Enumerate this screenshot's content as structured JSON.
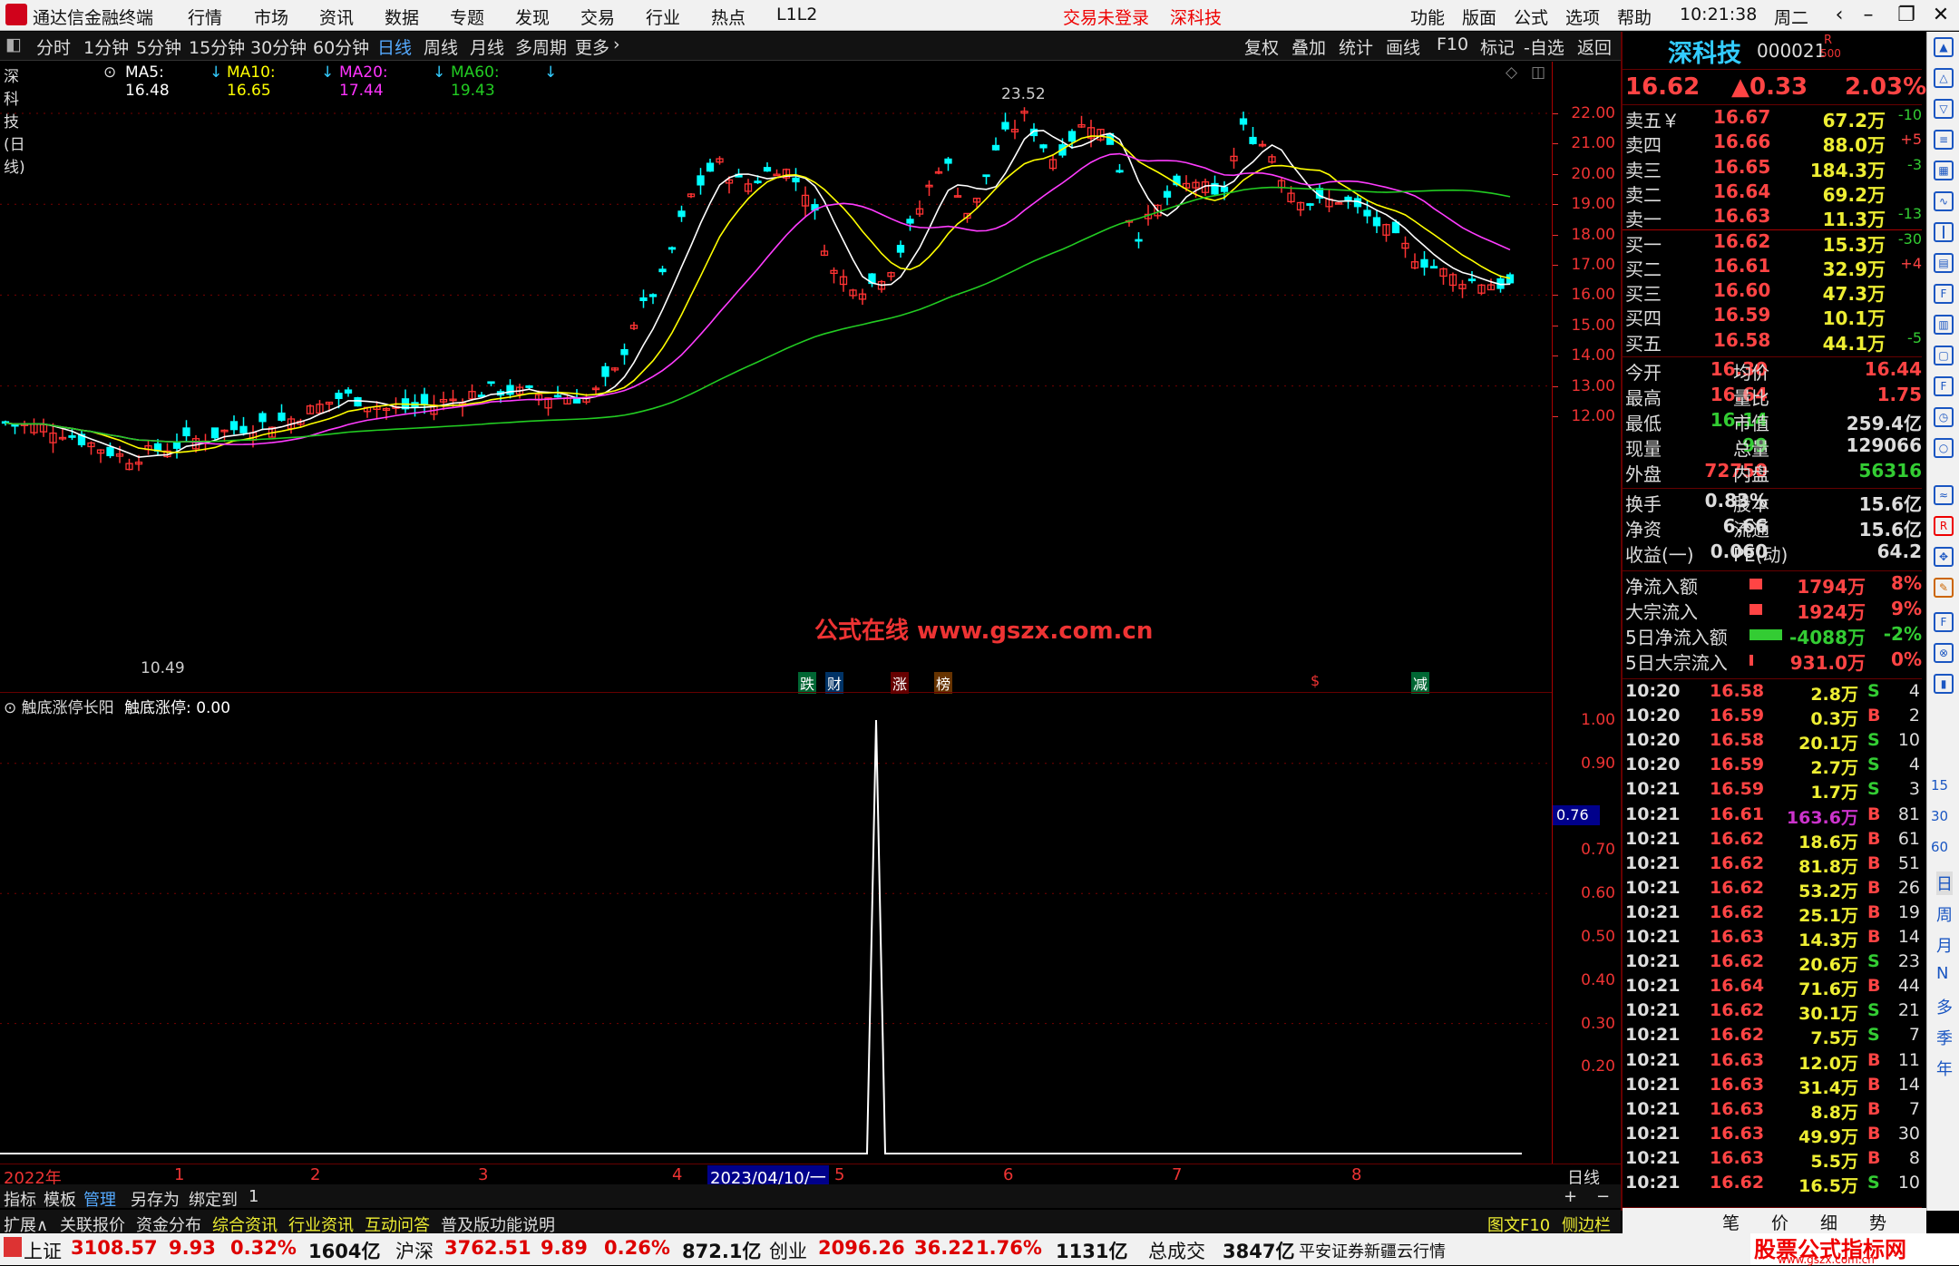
{
  "titlebar": {
    "app_name": "通达信金融终端",
    "menus": [
      "行情",
      "市场",
      "资讯",
      "数据",
      "专题",
      "发现",
      "交易",
      "行业",
      "热点",
      "L1L2"
    ],
    "trade_status": "交易未登录",
    "stock_name": "深科技",
    "right_menus": [
      "功能",
      "版面",
      "公式",
      "选项",
      "帮助"
    ],
    "time": "10:21:38",
    "weekday": "周二"
  },
  "timeframes": [
    "分时",
    "1分钟",
    "5分钟",
    "15分钟",
    "30分钟",
    "60分钟",
    "日线",
    "周线",
    "月线",
    "多周期",
    "更多"
  ],
  "active_timeframe": "日线",
  "tools": [
    "复权",
    "叠加",
    "统计",
    "画线",
    "F10",
    "标记",
    "-自选",
    "返回"
  ],
  "ma_bar": {
    "title": "深科技(日线)",
    "ma5": "MA5: 16.48",
    "ma10": "MA10: 16.65",
    "ma20": "MA20: 17.44",
    "ma60": "MA60: 19.43"
  },
  "colors": {
    "ma5": "#ffffff",
    "ma10": "#ffff00",
    "ma20": "#ff3cff",
    "ma60": "#22cc22",
    "up": "#ff3333",
    "down": "#00ffff"
  },
  "price_axis": [
    "22.00",
    "21.00",
    "20.00",
    "19.00",
    "18.00",
    "17.00",
    "16.00",
    "15.00",
    "14.00",
    "13.00",
    "12.00"
  ],
  "price_high_label": "23.52",
  "price_low_label": "10.49",
  "watermark": "公式在线  www.gszx.com.cn",
  "event_tags": [
    "跌",
    "财",
    "涨",
    "榜",
    "$",
    "减"
  ],
  "indicator": {
    "name": "触底涨停长阳",
    "value_label": "触底涨停: 0.00",
    "axis": [
      "1.00",
      "0.90",
      "0.70",
      "0.60",
      "0.50",
      "0.40",
      "0.30",
      "0.20"
    ],
    "current_tag": "0.76"
  },
  "x_axis": {
    "labels": [
      "2022年",
      "1",
      "2",
      "3",
      "4",
      "2023/04/10/一",
      "5",
      "6",
      "7",
      "8"
    ],
    "period": "日线"
  },
  "bottom_tabs1": [
    "指标",
    "模板",
    "管理",
    "另存为",
    "绑定到",
    "1"
  ],
  "bottom_tabs2": [
    "扩展∧",
    "关联报价",
    "资金分布",
    "综合资讯",
    "行业资讯",
    "互动问答",
    "普及版功能说明"
  ],
  "bottom_right": [
    "图文F10",
    "侧边栏《"
  ],
  "quote": {
    "name": "深科技",
    "code": "000021",
    "margin_tag": "R",
    "margin_sub": "500",
    "price": "16.62",
    "change": "▲0.33",
    "pct": "2.03%",
    "asks": [
      {
        "label": "卖五￥",
        "price": "16.67",
        "vol": "67.2万",
        "chg": "-10"
      },
      {
        "label": "卖四",
        "price": "16.66",
        "vol": "88.0万",
        "chg": "+5"
      },
      {
        "label": "卖三",
        "price": "16.65",
        "vol": "184.3万",
        "chg": "-3"
      },
      {
        "label": "卖二",
        "price": "16.64",
        "vol": "69.2万",
        "chg": ""
      },
      {
        "label": "卖一",
        "price": "16.63",
        "vol": "11.3万",
        "chg": "-13"
      }
    ],
    "bids": [
      {
        "label": "买一",
        "price": "16.62",
        "vol": "15.3万",
        "chg": "-30"
      },
      {
        "label": "买二",
        "price": "16.61",
        "vol": "32.9万",
        "chg": "+4"
      },
      {
        "label": "买三",
        "price": "16.60",
        "vol": "47.3万",
        "chg": ""
      },
      {
        "label": "买四",
        "price": "16.59",
        "vol": "10.1万",
        "chg": ""
      },
      {
        "label": "买五",
        "price": "16.58",
        "vol": "44.1万",
        "chg": "-5"
      }
    ],
    "stats": [
      {
        "l1": "今开",
        "v1": "16.30",
        "l2": "均价",
        "v2": "16.44"
      },
      {
        "l1": "最高",
        "v1": "16.64",
        "l2": "量比",
        "v2": "1.75"
      },
      {
        "l1": "最低",
        "v1": "16.14",
        "l2": "市值",
        "v2": "259.4亿"
      },
      {
        "l1": "现量",
        "v1": "99",
        "l2": "总量",
        "v2": "129066"
      },
      {
        "l1": "外盘",
        "v1": "72750",
        "l2": "内盘",
        "v2": "56316"
      }
    ],
    "stats2": [
      {
        "l1": "换手",
        "v1": "0.83%",
        "l2": "股本",
        "v2": "15.6亿"
      },
      {
        "l1": "净资",
        "v1": "6.66",
        "l2": "流通",
        "v2": "15.6亿"
      },
      {
        "l1": "收益(一)",
        "v1": "0.060",
        "l2": "PE(动)",
        "v2": "64.2"
      }
    ],
    "flows": [
      {
        "label": "净流入额",
        "value": "1794万",
        "pct": "8%"
      },
      {
        "label": "大宗流入",
        "value": "1924万",
        "pct": "9%"
      },
      {
        "label": "5日净流入额",
        "value": "-4088万",
        "pct": "-2%"
      },
      {
        "label": "5日大宗流入",
        "value": "931.0万",
        "pct": "0%"
      }
    ],
    "ticks": [
      {
        "t": "10:20",
        "p": "16.58",
        "v": "2.8万",
        "s": "S",
        "n": "4"
      },
      {
        "t": "10:20",
        "p": "16.59",
        "v": "0.3万",
        "s": "B",
        "n": "2"
      },
      {
        "t": "10:20",
        "p": "16.58",
        "v": "20.1万",
        "s": "S",
        "n": "10"
      },
      {
        "t": "10:20",
        "p": "16.59",
        "v": "2.7万",
        "s": "S",
        "n": "4"
      },
      {
        "t": "10:21",
        "p": "16.59",
        "v": "1.7万",
        "s": "S",
        "n": "3"
      },
      {
        "t": "10:21",
        "p": "16.61",
        "v": "163.6万",
        "s": "B",
        "n": "81"
      },
      {
        "t": "10:21",
        "p": "16.62",
        "v": "18.6万",
        "s": "B",
        "n": "61"
      },
      {
        "t": "10:21",
        "p": "16.62",
        "v": "81.8万",
        "s": "B",
        "n": "51"
      },
      {
        "t": "10:21",
        "p": "16.62",
        "v": "53.2万",
        "s": "B",
        "n": "26"
      },
      {
        "t": "10:21",
        "p": "16.62",
        "v": "25.1万",
        "s": "B",
        "n": "19"
      },
      {
        "t": "10:21",
        "p": "16.63",
        "v": "14.3万",
        "s": "B",
        "n": "14"
      },
      {
        "t": "10:21",
        "p": "16.62",
        "v": "20.6万",
        "s": "S",
        "n": "23"
      },
      {
        "t": "10:21",
        "p": "16.64",
        "v": "71.6万",
        "s": "B",
        "n": "44"
      },
      {
        "t": "10:21",
        "p": "16.62",
        "v": "30.1万",
        "s": "S",
        "n": "21"
      },
      {
        "t": "10:21",
        "p": "16.62",
        "v": "7.5万",
        "s": "S",
        "n": "7"
      },
      {
        "t": "10:21",
        "p": "16.63",
        "v": "12.0万",
        "s": "B",
        "n": "11"
      },
      {
        "t": "10:21",
        "p": "16.63",
        "v": "31.4万",
        "s": "B",
        "n": "14"
      },
      {
        "t": "10:21",
        "p": "16.63",
        "v": "8.8万",
        "s": "B",
        "n": "7"
      },
      {
        "t": "10:21",
        "p": "16.63",
        "v": "49.9万",
        "s": "B",
        "n": "30"
      },
      {
        "t": "10:21",
        "p": "16.63",
        "v": "5.5万",
        "s": "B",
        "n": "8"
      },
      {
        "t": "10:21",
        "p": "16.62",
        "v": "16.5万",
        "s": "S",
        "n": "10"
      }
    ],
    "panel_tabs": [
      "笔",
      "价",
      "细",
      "势"
    ]
  },
  "right_sidebar": [
    "15",
    "30",
    "60",
    "日",
    "周",
    "月",
    "N",
    "多",
    "季",
    "年"
  ],
  "statusbar": {
    "sh_label": "上证",
    "sh_val": "3108.57",
    "sh_chg": "9.93",
    "sh_pct": "0.32%",
    "sh_amt": "1604亿",
    "hs_label": "沪深",
    "hs_val": "3762.51",
    "hs_chg": "9.89",
    "hs_pct": "0.26%",
    "hs_amt": "872.1亿",
    "cy_label": "创业",
    "cy_val": "2096.26",
    "cy_chg": "36.22",
    "cy_pct": "1.76%",
    "cy_amt": "1131亿",
    "total_label": "总成交",
    "total_val": "3847亿",
    "broker": "平安证券新疆云行情",
    "brand": "股票公式指标网",
    "brand_url": "www.gszx.com.cn"
  }
}
